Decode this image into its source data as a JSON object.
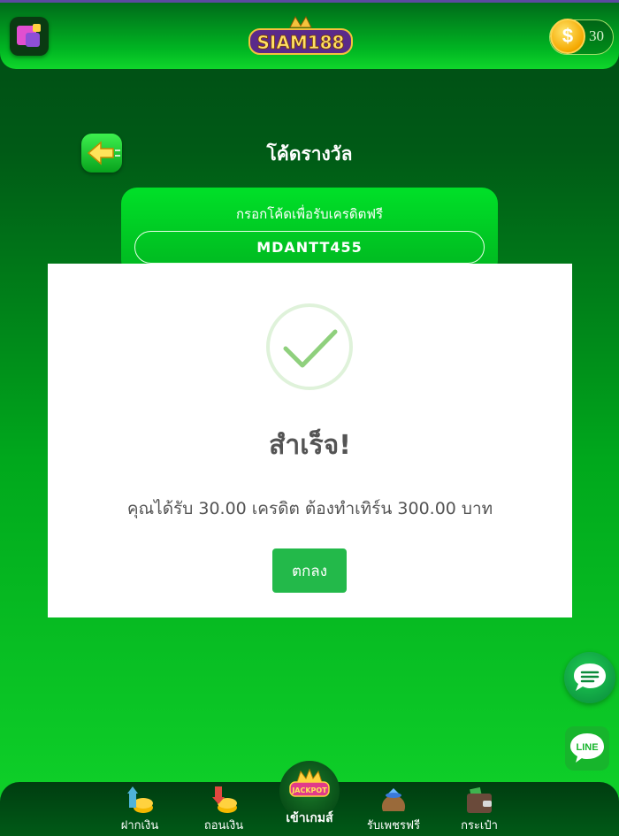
{
  "header": {
    "logo_text": "SIAM188",
    "coin_symbol": "$",
    "coin_balance": "30"
  },
  "page": {
    "title": "โค้ดรางวัล"
  },
  "redeem": {
    "label": "กรอกโค้ดเพื่อรับเครดิตฟรี",
    "code_value": "MDANTT455"
  },
  "modal": {
    "title": "สำเร็จ!",
    "message": "คุณได้รับ 30.00 เครดิต ต้องทำเทิร์น 300.00 บาท",
    "ok_label": "ตกลง"
  },
  "floating": {
    "line_label": "LINE"
  },
  "bottom_nav": {
    "items": [
      {
        "label": "ฝากเงิน",
        "icon": "deposit-icon"
      },
      {
        "label": "ถอนเงิน",
        "icon": "withdraw-icon"
      },
      {
        "label": "เข้าเกมส์",
        "icon": "jackpot-icon",
        "badge": "JACKPOT"
      },
      {
        "label": "รับเพชรฟรี",
        "icon": "diamond-bag-icon"
      },
      {
        "label": "กระเป๋า",
        "icon": "wallet-icon"
      }
    ]
  },
  "colors": {
    "accent_green": "#00b620",
    "button_green": "#23b94a",
    "coin_gold": "#f5a800"
  }
}
